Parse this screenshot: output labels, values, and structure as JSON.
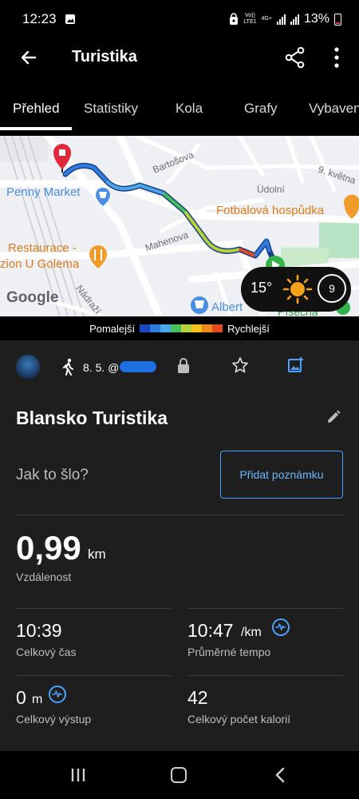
{
  "status_bar": {
    "time": "12:23",
    "network_top": "Vo))",
    "network_bottom": "LTE1",
    "network_type": "4G+",
    "battery": "13%",
    "battery_level_percent": 13
  },
  "app_bar": {
    "title": "Turistika",
    "back_icon": "arrow-left-icon",
    "share_icon": "share-icon",
    "more_icon": "more-vert-icon"
  },
  "tabs": [
    {
      "label": "Přehled",
      "active": true
    },
    {
      "label": "Statistiky",
      "active": false
    },
    {
      "label": "Kola",
      "active": false
    },
    {
      "label": "Grafy",
      "active": false
    },
    {
      "label": "Vybaven",
      "active": false
    }
  ],
  "map": {
    "labels": {
      "bartosova": "Bartošova",
      "penny": "Penny Market",
      "udolni": "Údolní",
      "kvetna": "9. května",
      "fotbalova": "Fotbalová hospůdka",
      "restaurace_1": "Restaurace -",
      "restaurace_2": "zion U Golema",
      "mahenova": "Mahenova",
      "nadrazi": "Nádraží",
      "albert": "Albert",
      "pisecna": "Písečná",
      "google": "Google"
    },
    "weather": {
      "temperature": "15°",
      "badge": "9",
      "icon": "sun-icon"
    }
  },
  "legend": {
    "slower": "Pomalejší",
    "faster": "Rychlejší",
    "colors": [
      "#1a46c2",
      "#2f7ce0",
      "#4aa8e8",
      "#46c05a",
      "#b7d33a",
      "#f5c21b",
      "#f08a1c",
      "#e34a1e"
    ]
  },
  "activity": {
    "date": "8. 5. @",
    "title": "Blansko Turistika",
    "mood_prompt": "Jak to šlo?",
    "note_button": "Přidat poznámku",
    "distance": {
      "value": "0,99",
      "unit": "km",
      "label": "Vzdálenost"
    },
    "stats": [
      {
        "value": "10:39",
        "unit": "",
        "label": "Celkový čas"
      },
      {
        "value": "10:47",
        "unit": "/km",
        "label": "Průměrné tempo"
      },
      {
        "value": "0",
        "unit": "m",
        "label": "Celkový výstup"
      },
      {
        "value": "42",
        "unit": "",
        "label": "Celkový počet kalorií"
      }
    ]
  },
  "nav_bar": {
    "recents_icon": "recents-icon",
    "home_icon": "home-icon",
    "back_icon": "nav-back-icon"
  }
}
